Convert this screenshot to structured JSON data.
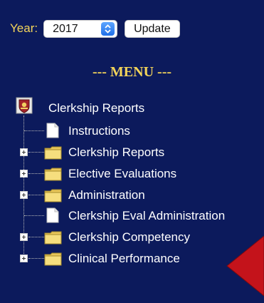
{
  "form": {
    "year_label": "Year:",
    "year_value": "2017",
    "update_label": "Update"
  },
  "menu": {
    "title": "--- MENU ---",
    "root": {
      "label": "Clerkship Reports",
      "icon": "crest-icon"
    },
    "items": [
      {
        "label": "Instructions",
        "type": "document",
        "expandable": false
      },
      {
        "label": "Clerkship Reports",
        "type": "folder",
        "expandable": true
      },
      {
        "label": "Elective Evaluations",
        "type": "folder",
        "expandable": true
      },
      {
        "label": "Administration",
        "type": "folder",
        "expandable": true
      },
      {
        "label": "Clerkship Eval Administration",
        "type": "document",
        "expandable": false
      },
      {
        "label": "Clerkship Competency",
        "type": "folder",
        "expandable": true
      },
      {
        "label": "Clinical Performance",
        "type": "folder",
        "expandable": true
      }
    ]
  },
  "colors": {
    "background": "#0c1a5c",
    "label_gold": "#f3d45a",
    "arrow_red": "#c4131b"
  },
  "annotation": {
    "icon": "red-arrow-pointer-icon"
  }
}
